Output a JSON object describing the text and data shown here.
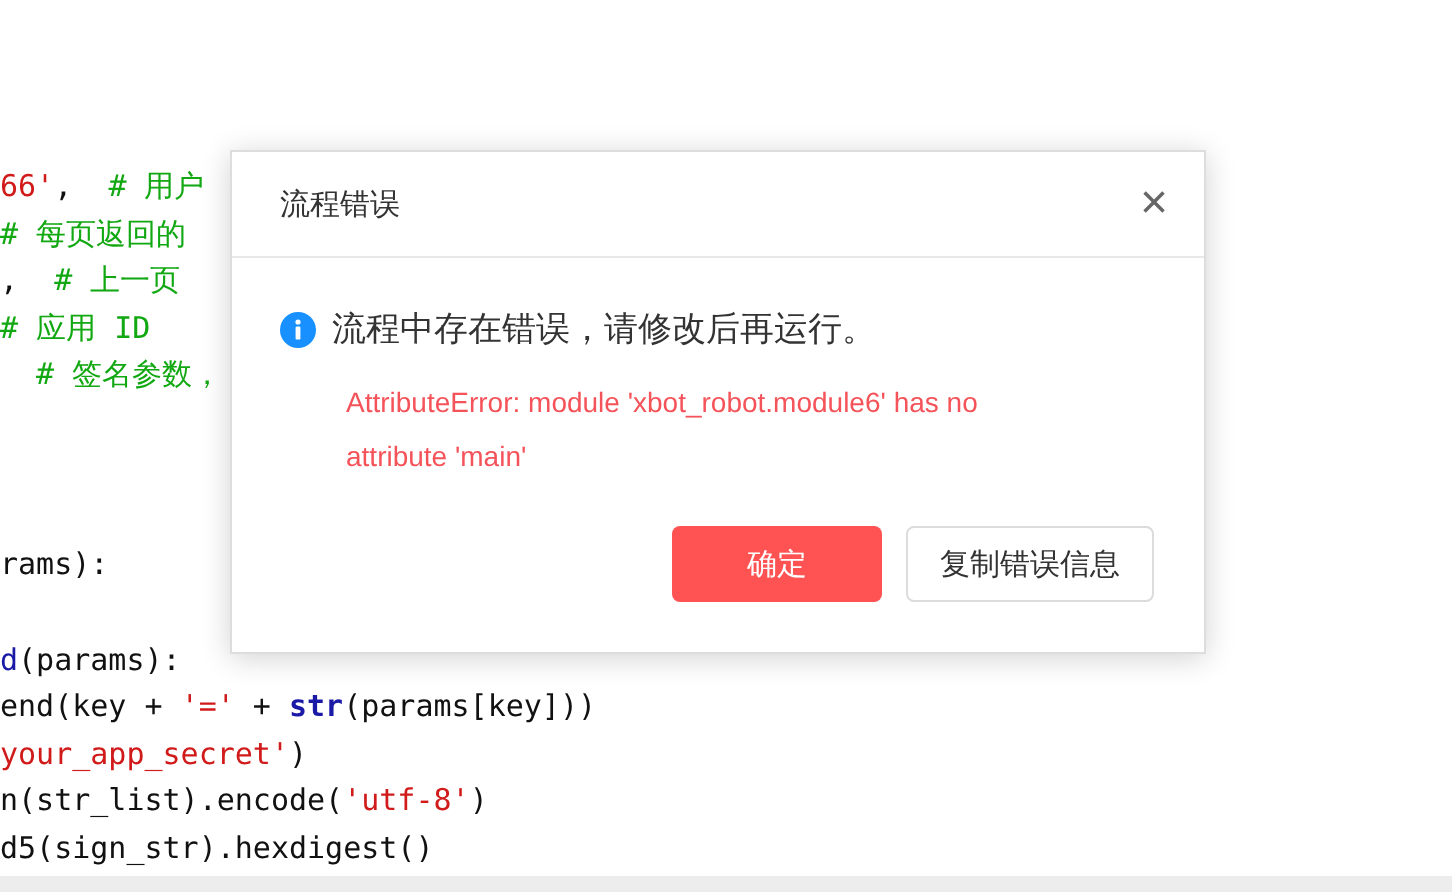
{
  "code_blocks": [
    {
      "lines": [
        [
          {
            "text": "66'",
            "kind": "string"
          },
          {
            "text": ",  ",
            "kind": "plain"
          },
          {
            "text": "# 用户",
            "kind": "comment"
          }
        ],
        [
          {
            "text": "# 每页返回的",
            "kind": "comment"
          }
        ],
        [
          {
            "text": ",  ",
            "kind": "plain"
          },
          {
            "text": "# 上一页",
            "kind": "comment"
          }
        ],
        [
          {
            "text": "# 应用 ID",
            "kind": "comment"
          }
        ],
        [
          {
            "text": "# 签名参数，",
            "kind": "comment"
          }
        ]
      ]
    },
    {
      "lines": [
        [
          {
            "text": "rams):",
            "kind": "plain"
          }
        ]
      ]
    },
    {
      "lines": [
        [
          {
            "text": "d",
            "kind": "function"
          },
          {
            "text": "(params):",
            "kind": "plain"
          }
        ],
        [
          {
            "text": "end(key + ",
            "kind": "plain"
          },
          {
            "text": "'='",
            "kind": "string"
          },
          {
            "text": " + ",
            "kind": "plain"
          },
          {
            "text": "str",
            "kind": "builtin"
          },
          {
            "text": "(params[key]))",
            "kind": "plain"
          }
        ],
        [
          {
            "text": "your_app_secret'",
            "kind": "string"
          },
          {
            "text": ")",
            "kind": "plain"
          }
        ],
        [
          {
            "text": "n(str_list).encode(",
            "kind": "plain"
          },
          {
            "text": "'utf-8'",
            "kind": "string"
          },
          {
            "text": ")",
            "kind": "plain"
          }
        ],
        [
          {
            "text": "d5(sign_str).hexdigest()",
            "kind": "plain"
          }
        ]
      ]
    }
  ],
  "dialog": {
    "title": "流程错误",
    "close": "×",
    "message": "流程中存在错误，请修改后再运行。",
    "error": "AttributeError: module 'xbot_robot.module6' has no attribute 'main'",
    "buttons": [
      {
        "label": "确定",
        "kind": "primary"
      },
      {
        "label": "复制错误信息",
        "kind": "default"
      }
    ]
  }
}
